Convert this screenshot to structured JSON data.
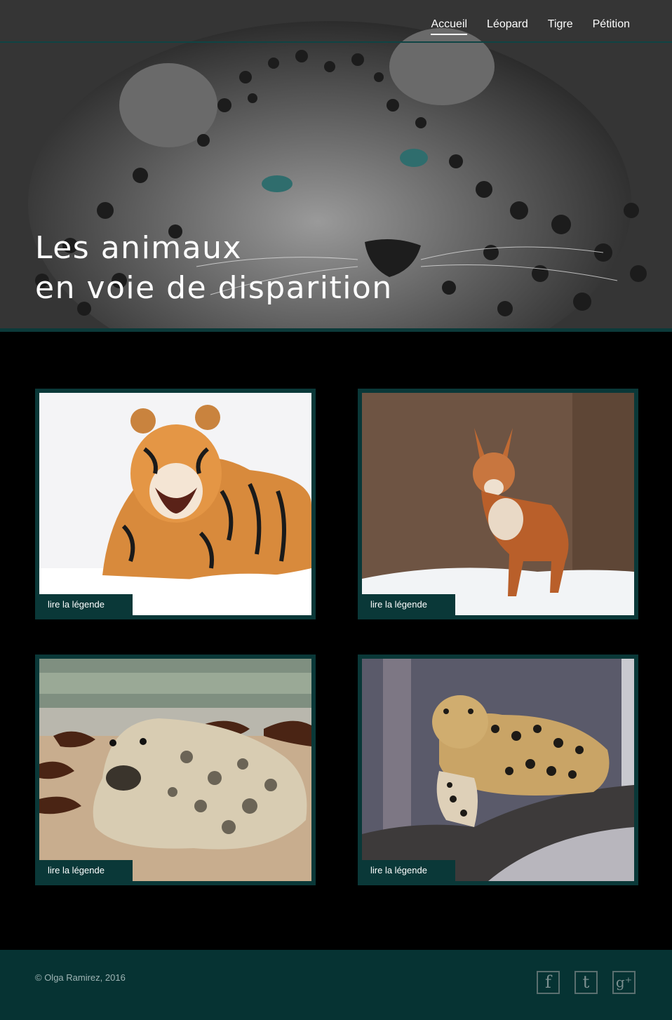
{
  "nav": {
    "items": [
      {
        "label": "Accueil",
        "active": true
      },
      {
        "label": "Léopard",
        "active": false
      },
      {
        "label": "Tigre",
        "active": false
      },
      {
        "label": "Pétition",
        "active": false
      }
    ]
  },
  "hero": {
    "title_line1": "Les animaux",
    "title_line2": "en voie de disparition"
  },
  "cards": [
    {
      "animal": "tigre",
      "caption": "lire la légende"
    },
    {
      "animal": "dhole",
      "caption": "lire la légende"
    },
    {
      "animal": "phoque",
      "caption": "lire la légende"
    },
    {
      "animal": "léopard",
      "caption": "lire la légende"
    }
  ],
  "footer": {
    "copyright": "© Olga Ramirez, 2016",
    "social": [
      {
        "icon": "facebook-icon",
        "glyph": "f"
      },
      {
        "icon": "twitter-icon",
        "glyph": "t"
      },
      {
        "icon": "google-plus-icon",
        "glyph": "g⁺"
      }
    ]
  },
  "colors": {
    "accent": "#0a3838",
    "footer_bg": "#063333",
    "background": "#000000"
  }
}
